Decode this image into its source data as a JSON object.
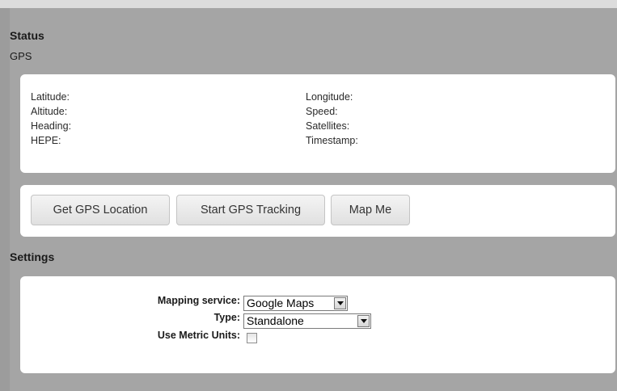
{
  "status": {
    "title": "Status",
    "subtitle": "GPS",
    "fields": {
      "latitude": "Latitude:",
      "altitude": "Altitude:",
      "heading": "Heading:",
      "hepe": "HEPE:",
      "longitude": "Longitude:",
      "speed": "Speed:",
      "satellites": "Satellites:",
      "timestamp": "Timestamp:"
    }
  },
  "actions": {
    "get_location": "Get GPS Location",
    "start_tracking": "Start GPS Tracking",
    "map_me": "Map Me"
  },
  "settings": {
    "title": "Settings",
    "mapping_service_label": "Mapping service:",
    "mapping_service_value": "Google Maps",
    "type_label": "Type:",
    "type_value": "Standalone",
    "metric_label": "Use Metric Units:",
    "metric_checked": false
  },
  "icons": {
    "select_arrow": "chevron-down-icon"
  },
  "colors": {
    "background": "#a5a5a5",
    "panel": "#ffffff",
    "button": "#e8e8e8"
  }
}
